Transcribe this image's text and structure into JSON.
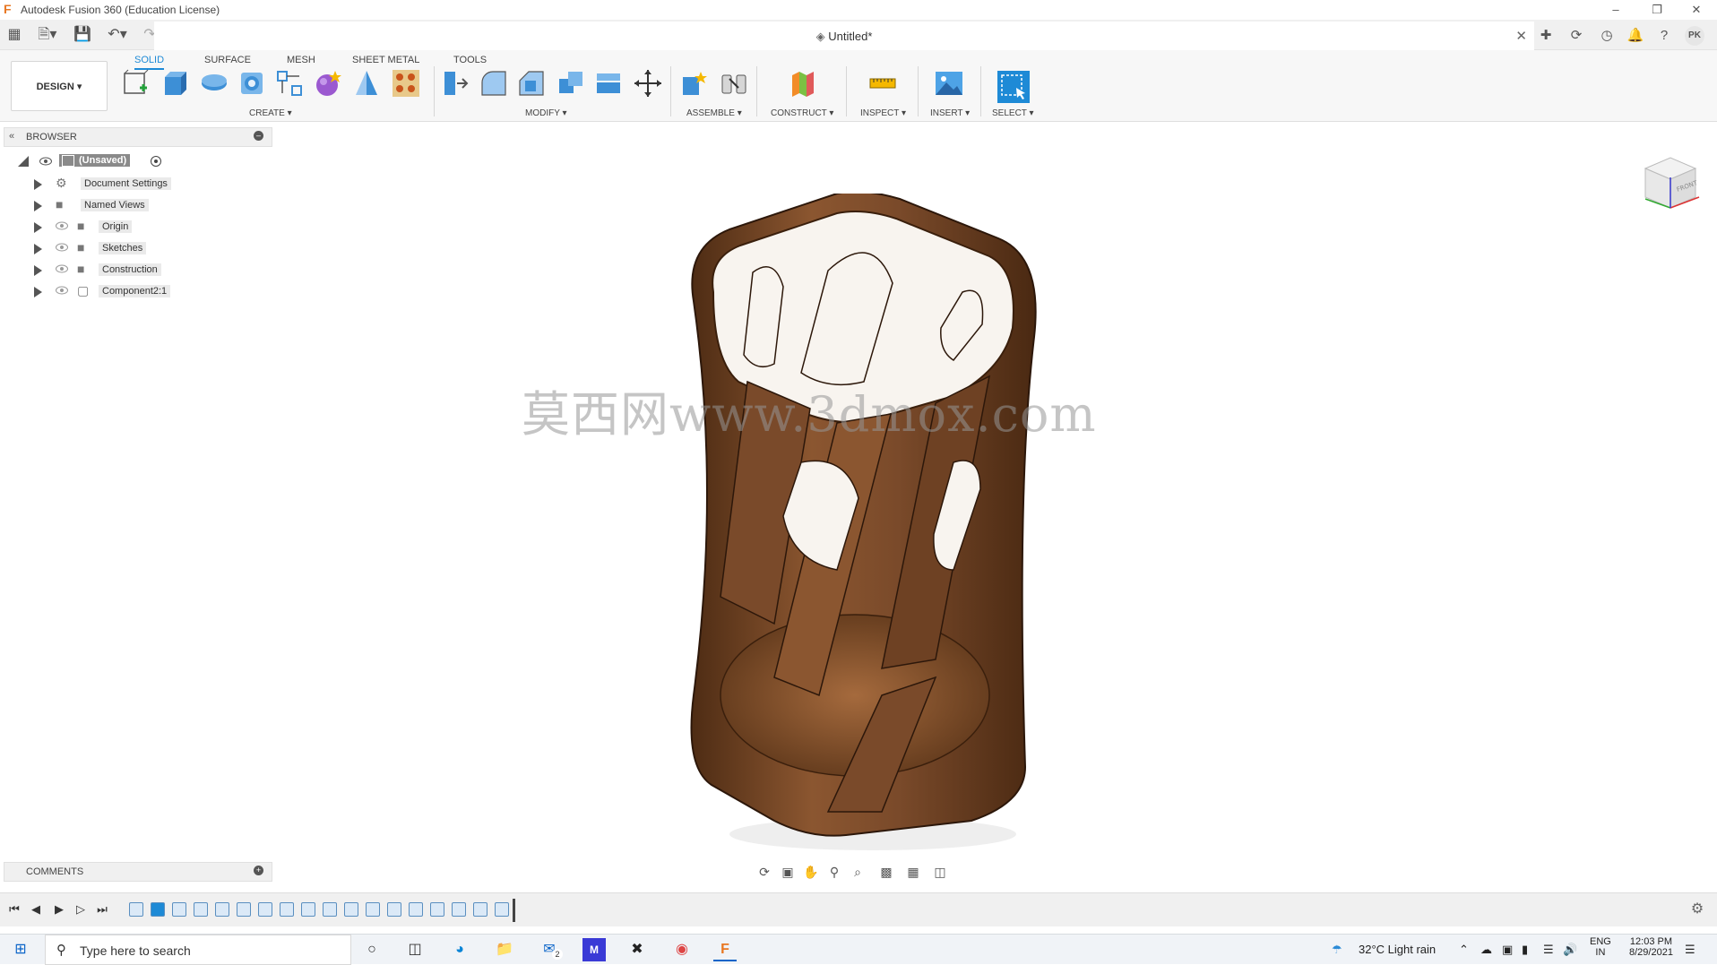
{
  "window": {
    "title": "Autodesk Fusion 360 (Education License)",
    "controls": [
      "minimize",
      "restore",
      "close"
    ]
  },
  "document": {
    "tab_title": "Untitled*"
  },
  "user": {
    "initials": "PK"
  },
  "ribbon": {
    "tabs": [
      {
        "label": "SOLID",
        "active": true
      },
      {
        "label": "SURFACE",
        "active": false
      },
      {
        "label": "MESH",
        "active": false
      },
      {
        "label": "SHEET METAL",
        "active": false
      },
      {
        "label": "TOOLS",
        "active": false
      }
    ],
    "workspace_label": "DESIGN ▾",
    "groups": {
      "create": "CREATE ▾",
      "modify": "MODIFY ▾",
      "assemble": "ASSEMBLE ▾",
      "construct": "CONSTRUCT ▾",
      "inspect": "INSPECT ▾",
      "insert": "INSERT ▾",
      "select": "SELECT ▾"
    }
  },
  "browser": {
    "title": "BROWSER",
    "root": "(Unsaved)",
    "items": [
      {
        "label": "Document Settings",
        "icon": "gear-icon"
      },
      {
        "label": "Named Views",
        "icon": "folder-icon"
      },
      {
        "label": "Origin",
        "icon": "folder-icon"
      },
      {
        "label": "Sketches",
        "icon": "folder-icon"
      },
      {
        "label": "Construction",
        "icon": "folder-icon"
      },
      {
        "label": "Component2:1",
        "icon": "component-icon"
      }
    ]
  },
  "comments": {
    "title": "COMMENTS"
  },
  "viewport": {
    "watermark": "莫西网www.3dmox.com",
    "viewcube_face": "FRONT",
    "model_color": "#7a4a2a"
  },
  "taskbar": {
    "search_placeholder": "Type here to search",
    "mail_badge": "2",
    "weather": "32°C  Light rain",
    "lang_top": "ENG",
    "lang_bottom": "IN",
    "time": "12:03 PM",
    "date": "8/29/2021"
  },
  "colors": {
    "accent": "#1e8ad6",
    "fusion_orange": "#e87722",
    "wood_dark": "#5b3519",
    "wood_light": "#a0683d"
  }
}
